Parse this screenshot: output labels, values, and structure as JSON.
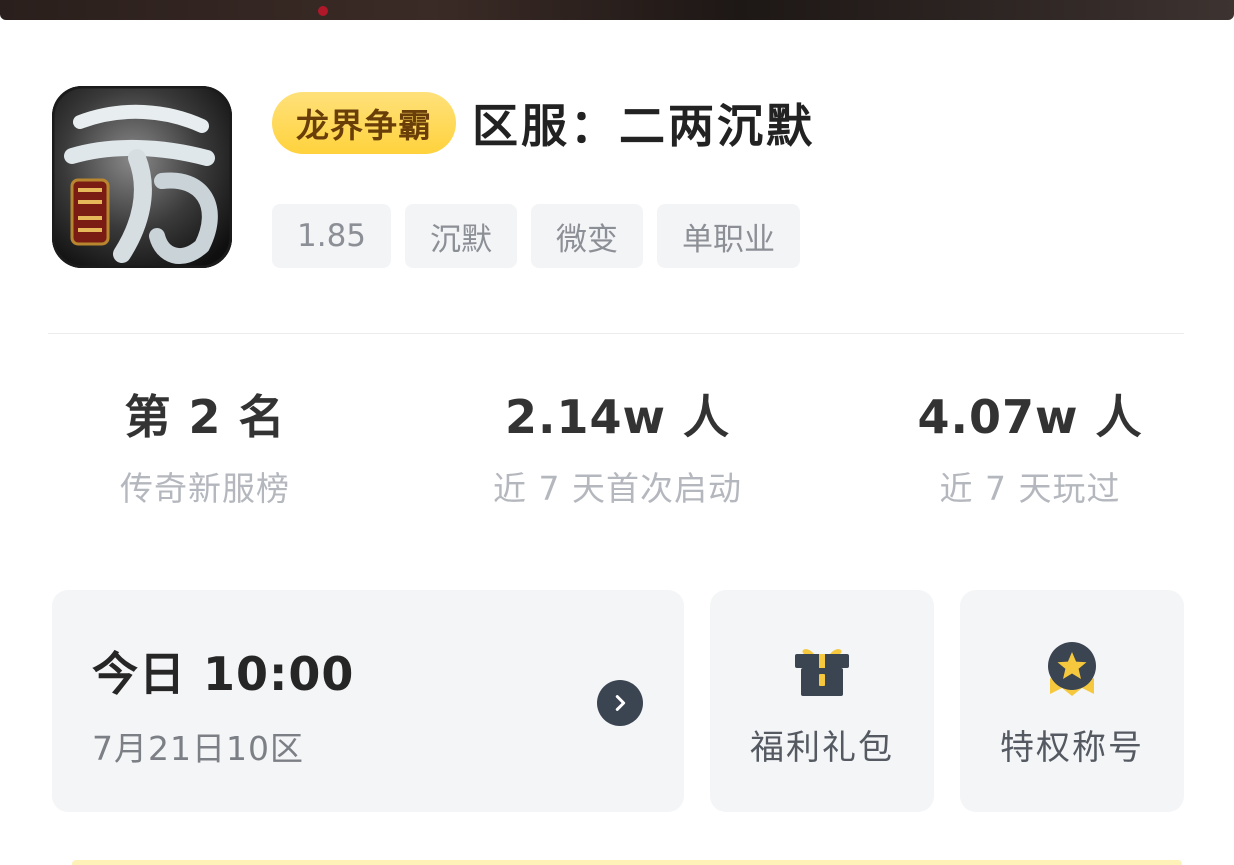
{
  "game": {
    "category": "龙界争霸",
    "server_title": "区服：二两沉默",
    "tags": [
      "1.85",
      "沉默",
      "微变",
      "单职业"
    ]
  },
  "stats": [
    {
      "value": "第 2 名",
      "label": "传奇新服榜"
    },
    {
      "value": "2.14w 人",
      "label": "近 7 天首次启动"
    },
    {
      "value": "4.07w 人",
      "label": "近 7 天玩过"
    }
  ],
  "server_open": {
    "time": "今日 10:00",
    "detail": "7月21日10区"
  },
  "actions": {
    "gift_label": "福利礼包",
    "title_label": "特权称号"
  },
  "colors": {
    "badge_bg": "#ffd23d",
    "badge_text": "#6a3e08",
    "card_bg": "#f4f5f7",
    "chevron_bg": "#3b4451",
    "gift_icon": "#3b4451",
    "gift_ribbon": "#f6c83d",
    "medal_gold": "#f6c83d"
  },
  "icons": {
    "app_icon": "game-logo-icon",
    "open_arrow": "chevron-right-icon",
    "gift": "gift-box-icon",
    "title": "medal-star-icon"
  }
}
